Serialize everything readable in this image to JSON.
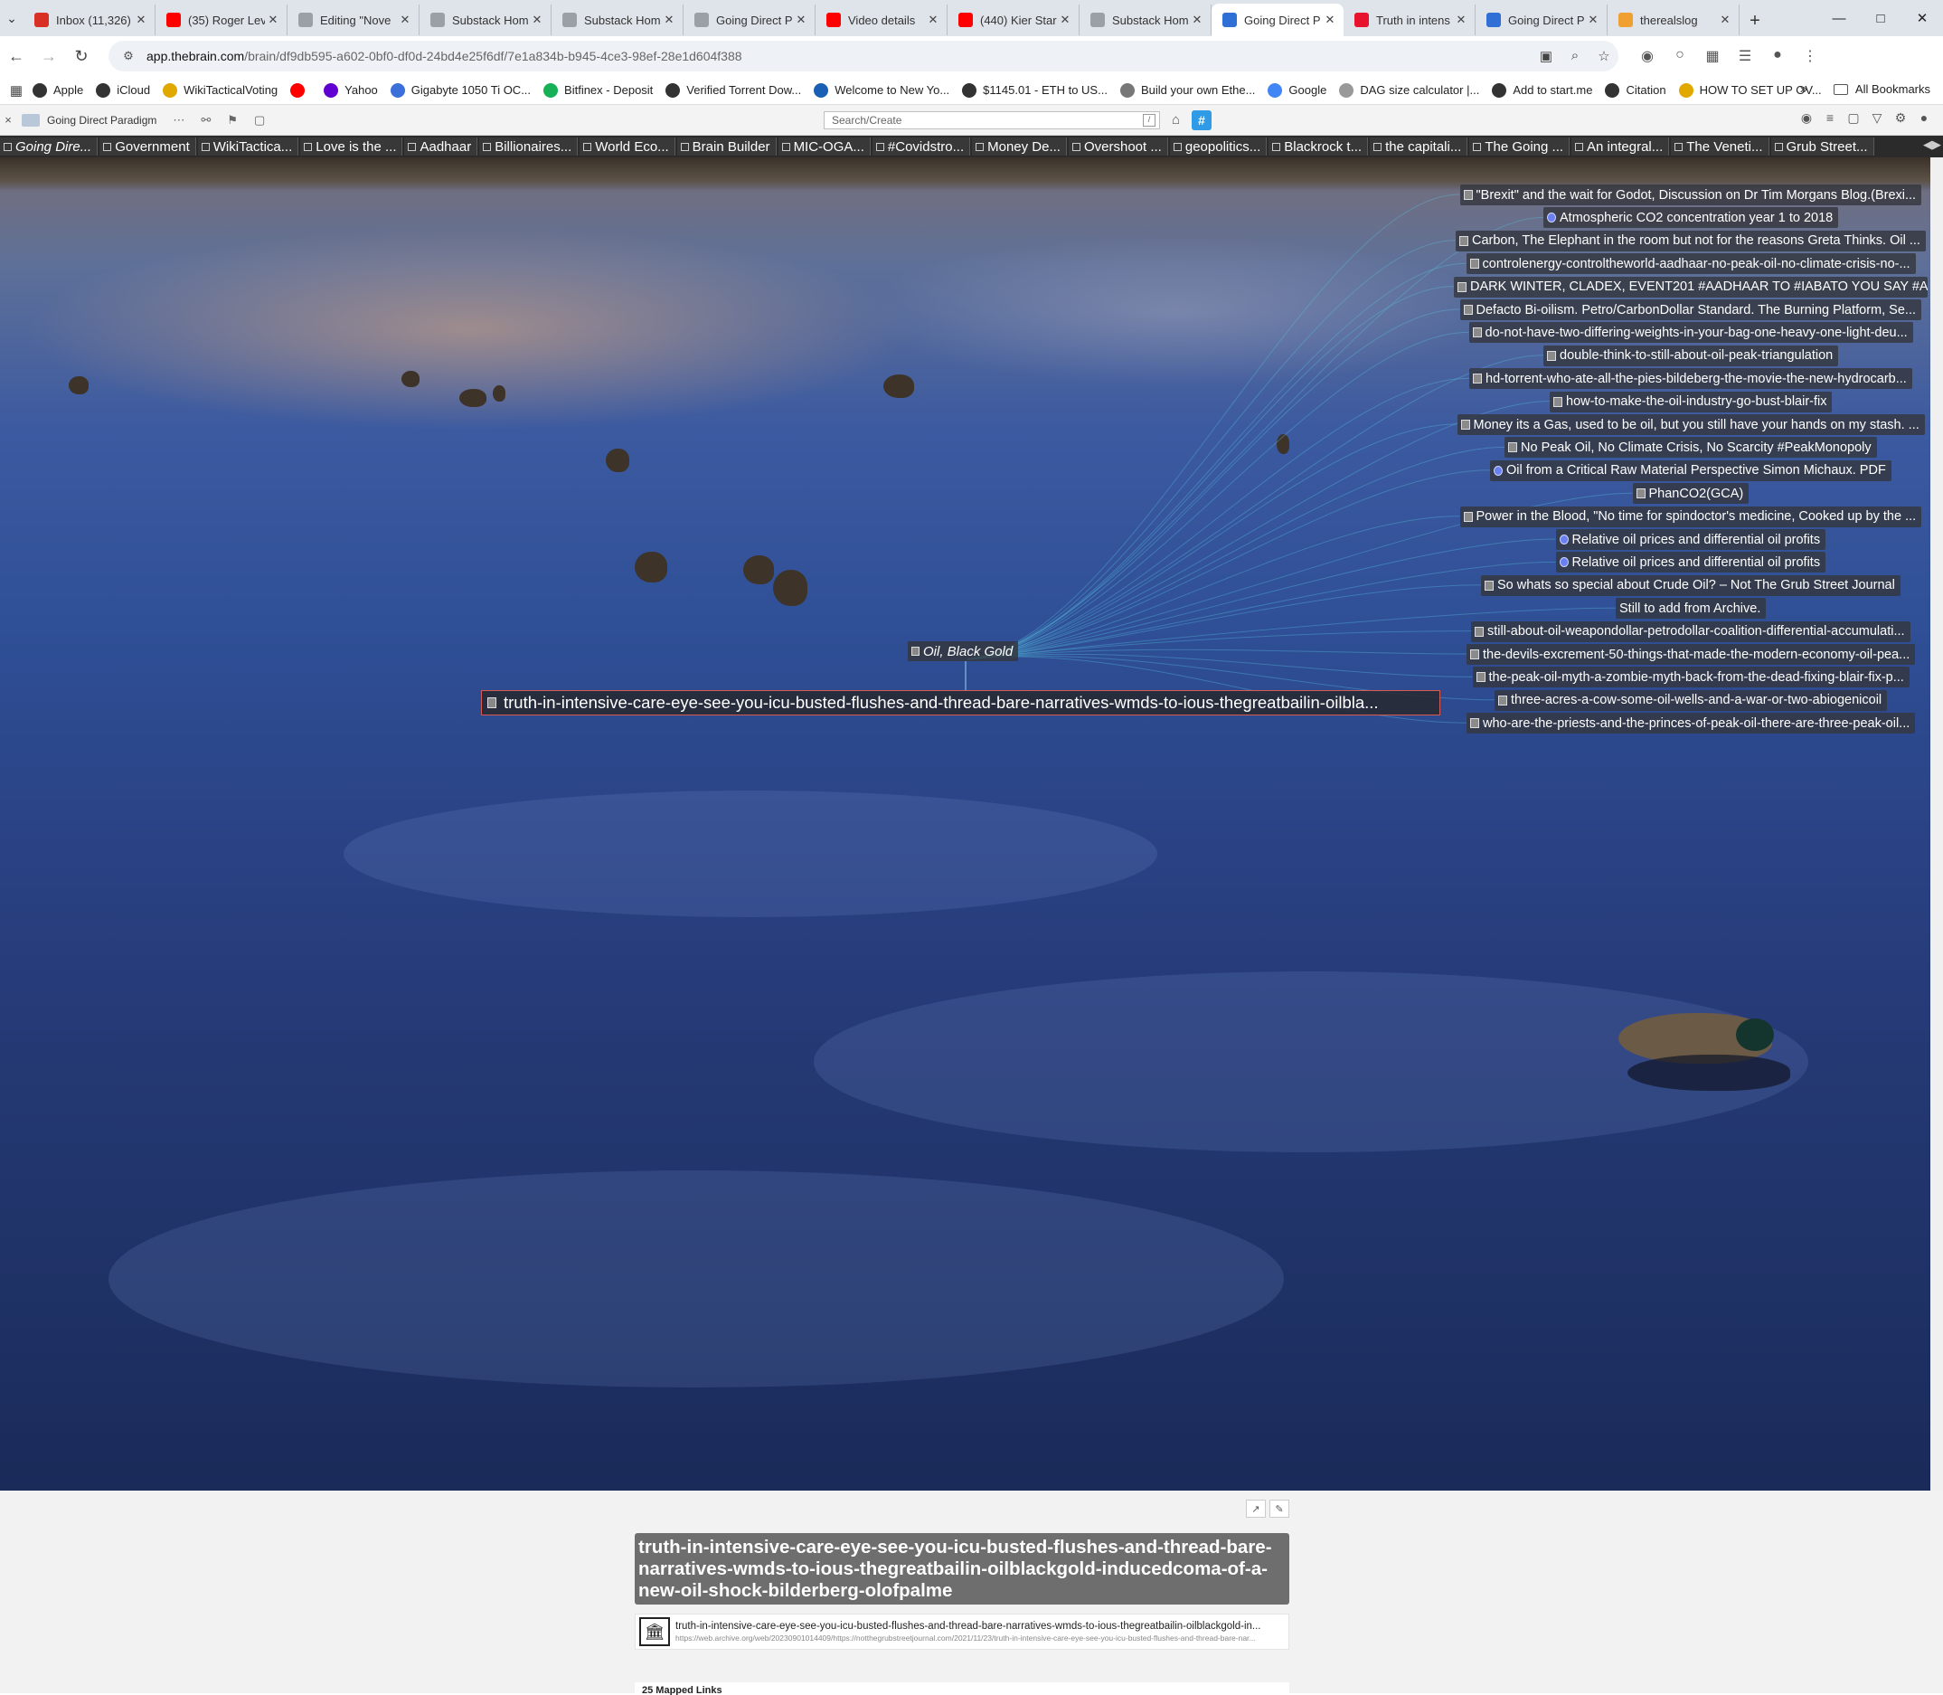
{
  "browser": {
    "tab_menu_icon": "chevron-down-icon",
    "tabs": [
      {
        "label": "Inbox (11,326)",
        "icon": "gmail-icon",
        "color": "#d93025",
        "active": false
      },
      {
        "label": "(35) Roger Lev",
        "icon": "youtube-icon",
        "color": "#ff0000",
        "active": false
      },
      {
        "label": "Editing \"Nove",
        "icon": "page-icon",
        "color": "#9aa0a6",
        "active": false
      },
      {
        "label": "Substack Hom",
        "icon": "page-icon",
        "color": "#9aa0a6",
        "active": false
      },
      {
        "label": "Substack Hom",
        "icon": "page-icon",
        "color": "#9aa0a6",
        "active": false
      },
      {
        "label": "Going Direct P",
        "icon": "page-icon",
        "color": "#9aa0a6",
        "active": false
      },
      {
        "label": "Video details",
        "icon": "youtube-icon",
        "color": "#ff0000",
        "active": false
      },
      {
        "label": "(440) Kier Star",
        "icon": "youtube-icon",
        "color": "#ff0000",
        "active": false
      },
      {
        "label": "Substack Hom",
        "icon": "page-icon",
        "color": "#9aa0a6",
        "active": false
      },
      {
        "label": "Going Direct P",
        "icon": "thebrain-icon",
        "color": "#2f6fd6",
        "active": true
      },
      {
        "label": "Truth in intens",
        "icon": "page-icon",
        "color": "#e8132c",
        "active": false
      },
      {
        "label": "Going Direct P",
        "icon": "thebrain-icon",
        "color": "#2f6fd6",
        "active": false
      },
      {
        "label": "therealslog",
        "icon": "page-icon",
        "color": "#f0a030",
        "active": false
      }
    ],
    "new_tab_icon": "plus-icon",
    "window_controls": [
      "minimize-icon",
      "maximize-icon",
      "close-icon"
    ],
    "address": {
      "host": "app.thebrain.com",
      "path": "/brain/df9db595-a602-0bf0-df0d-24bd4e25f6df/7e1a834b-b945-4ce3-98ef-28e1d604f388"
    },
    "bookmarks": [
      {
        "label": "Apple",
        "color": "#333333"
      },
      {
        "label": "iCloud",
        "color": "#333333"
      },
      {
        "label": "WikiTacticalVoting",
        "color": "#e0a800"
      },
      {
        "label": "",
        "color": "#ff0000"
      },
      {
        "label": "Yahoo",
        "color": "#6001d2"
      },
      {
        "label": "Gigabyte 1050 Ti OC...",
        "color": "#3b6fd9"
      },
      {
        "label": "Bitfinex - Deposit",
        "color": "#16b157"
      },
      {
        "label": "Verified Torrent Dow...",
        "color": "#333333"
      },
      {
        "label": "Welcome to New Yo...",
        "color": "#1a5fb4"
      },
      {
        "label": "$1145.01 - ETH to US...",
        "color": "#333333"
      },
      {
        "label": "Build your own Ethe...",
        "color": "#777777"
      },
      {
        "label": "Google",
        "color": "#4285f4"
      },
      {
        "label": "DAG size calculator |...",
        "color": "#999999"
      },
      {
        "label": "Add to start.me",
        "color": "#333333"
      },
      {
        "label": "Citation",
        "color": "#333333"
      },
      {
        "label": "HOW TO SET UP OV...",
        "color": "#e0a800"
      }
    ],
    "all_bookmarks": "All Bookmarks"
  },
  "brain": {
    "name": "Going Direct Paradigm",
    "search_placeholder": "Search/Create",
    "pins": [
      "Going Dire...",
      "Government",
      "WikiTactica...",
      "Love is the ...",
      "Aadhaar",
      "Billionaires...",
      "World Eco...",
      "Brain Builder",
      "MIC-OGA...",
      "#Covidstro...",
      "Money De...",
      "Overshoot ...",
      "geopolitics...",
      "Blackrock t...",
      "the capitali...",
      "The Going ...",
      "An integral...",
      "The Veneti...",
      "Grub Street..."
    ],
    "parent_thought": "Oil, Black Gold",
    "active_thought": "truth-in-intensive-care-eye-see-you-icu-busted-flushes-and-thread-bare-narratives-wmds-to-ious-thegreatbailin-oilbla...",
    "children": [
      {
        "label": "\"Brexit\" and the wait for Godot, Discussion on Dr Tim Morgans Blog.(Brexi...",
        "type": "note"
      },
      {
        "label": "Atmospheric CO2 concentration year 1 to 2018",
        "type": "web"
      },
      {
        "label": "Carbon, The Elephant in the room but not for the reasons Greta Thinks. Oil ...",
        "type": "note"
      },
      {
        "label": "controlenergy-controltheworld-aadhaar-no-peak-oil-no-climate-crisis-no-...",
        "type": "note"
      },
      {
        "label": "DARK WINTER, CLADEX, EVENT201 #AADHAAR TO #IABATO YOU SAY #A...",
        "type": "note"
      },
      {
        "label": "Defacto Bi-oilism. Petro/CarbonDollar Standard. The Burning Platform, Se...",
        "type": "note"
      },
      {
        "label": "do-not-have-two-differing-weights-in-your-bag-one-heavy-one-light-deu...",
        "type": "note"
      },
      {
        "label": "double-think-to-still-about-oil-peak-triangulation",
        "type": "note"
      },
      {
        "label": "hd-torrent-who-ate-all-the-pies-bildeberg-the-movie-the-new-hydrocarb...",
        "type": "note"
      },
      {
        "label": "how-to-make-the-oil-industry-go-bust-blair-fix",
        "type": "note"
      },
      {
        "label": "Money its a Gas, used to be oil, but you still have your hands on my stash. ...",
        "type": "note"
      },
      {
        "label": "No Peak Oil, No Climate Crisis, No Scarcity #PeakMonopoly",
        "type": "note"
      },
      {
        "label": "Oil from a Critical Raw Material Perspective Simon Michaux. PDF",
        "type": "web"
      },
      {
        "label": "PhanCO2(GCA)",
        "type": "note"
      },
      {
        "label": "Power in the Blood, \"No time for spindoctor's medicine, Cooked up by the ...",
        "type": "note"
      },
      {
        "label": "Relative oil prices and differential oil profits",
        "type": "web"
      },
      {
        "label": "Relative oil prices and differential oil profits",
        "type": "web"
      },
      {
        "label": "So whats so special about Crude Oil? – Not The Grub Street Journal",
        "type": "note"
      },
      {
        "label": "Still to add from Archive.",
        "type": "plain"
      },
      {
        "label": "still-about-oil-weapondollar-petrodollar-coalition-differential-accumulati...",
        "type": "note"
      },
      {
        "label": "the-devils-excrement-50-things-that-made-the-modern-economy-oil-pea...",
        "type": "note"
      },
      {
        "label": "the-peak-oil-myth-a-zombie-myth-back-from-the-dead-fixing-blair-fix-p...",
        "type": "note"
      },
      {
        "label": "three-acres-a-cow-some-oil-wells-and-a-war-or-two-abiogenicoil",
        "type": "note"
      },
      {
        "label": "who-are-the-priests-and-the-princes-of-peak-oil-there-are-three-peak-oil...",
        "type": "note"
      }
    ]
  },
  "notes": {
    "title": "truth-in-intensive-care-eye-see-you-icu-busted-flushes-and-thread-bare-narratives-wmds-to-ious-thegreatbailin-oilblackgold-inducedcoma-of-a-new-oil-shock-bilderberg-olofpalme",
    "attachment_name": "truth-in-intensive-care-eye-see-you-icu-busted-flushes-and-thread-bare-narratives-wmds-to-ious-thegreatbailin-oilblackgold-in...",
    "attachment_url": "https://web.archive.org/web/20230901014409/https://notthegrubstreetjournal.com/2021/11/23/truth-in-intensive-care-eye-see-you-icu-busted-flushes-and-thread-bare-nar...",
    "mapped_links": "25 Mapped Links"
  }
}
